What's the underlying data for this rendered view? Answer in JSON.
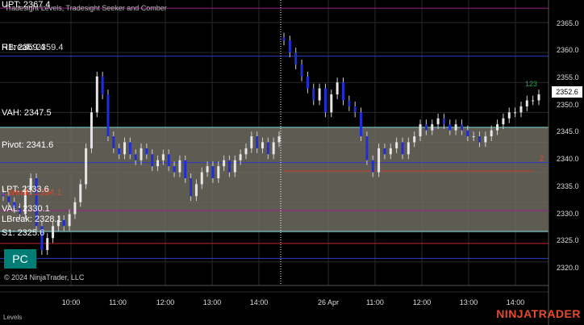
{
  "indicator_title": "Tradesight Levels, Tradesight Seeker and Comber",
  "levels": [
    {
      "key": "upt",
      "label": "UPT: 2367.4",
      "price": 2367.4,
      "color": "#9a1f8c"
    },
    {
      "key": "r1",
      "label": "R1: 2359.4",
      "price": 2359.4,
      "color": "#2b3cc8"
    },
    {
      "key": "vah",
      "label": "VAH: 2347.5",
      "price": 2347.5,
      "color": "#7fd8d8"
    },
    {
      "key": "pivot",
      "label": "Pivot: 2341.6",
      "price": 2341.6,
      "color": "#2b3cc8"
    },
    {
      "key": "lpt",
      "label": "LPT: 2333.6",
      "price": 2333.6,
      "color": "#9a1f8c"
    },
    {
      "key": "val",
      "label": "VAL: 2330.1",
      "price": 2330.1,
      "color": "#7fd8d8"
    },
    {
      "key": "lbreak",
      "label": "LBreak: 2328.1",
      "price": 2328.1,
      "color": "#c9201f"
    },
    {
      "key": "s1",
      "label": "S1: 2325.6",
      "price": 2325.6,
      "color": "#2b3cc8"
    }
  ],
  "overlap_labels": [
    "HBreak: 2359.4",
    "LBreak: 2334.1"
  ],
  "red_level_price": 2340.2,
  "pc_button": "PC",
  "copyright": "© 2024 NinjaTrader, LLC",
  "panel_label": "Levels",
  "brand": "NINJATRADER",
  "last_price": "2352.6",
  "markers": {
    "green": "123",
    "red": "2"
  },
  "chart_data": {
    "type": "candlestick",
    "y_ticks": [
      "2365.0",
      "2360.0",
      "2355.0",
      "2350.0",
      "2345.0",
      "2340.0",
      "2335.0",
      "2330.0",
      "2325.0",
      "2320.0"
    ],
    "ylim": [
      2318.0,
      2368.5
    ],
    "x_ticks": [
      "10:00",
      "11:00",
      "12:00",
      "13:00",
      "14:00",
      "26 Apr",
      "11:00",
      "12:00",
      "13:00",
      "14:00"
    ],
    "last_price": 2352.6,
    "session_one_closes": [
      2336,
      2335,
      2334,
      2333,
      2337,
      2339,
      2331,
      2327,
      2329,
      2331,
      2332,
      2331,
      2333,
      2335,
      2338,
      2344,
      2350,
      2356,
      2353,
      2346,
      2344,
      2343,
      2345,
      2343,
      2342,
      2344,
      2343,
      2341,
      2342,
      2343,
      2341,
      2340,
      2342,
      2339,
      2336,
      2338,
      2340,
      2341,
      2339,
      2341,
      2342,
      2340,
      2342,
      2343,
      2344,
      2346,
      2344,
      2345,
      2343,
      2345,
      2346
    ],
    "session_two_closes": [
      2362,
      2360,
      2358,
      2356,
      2354,
      2352,
      2354,
      2350,
      2353,
      2355,
      2352,
      2351,
      2350,
      2346,
      2342,
      2340,
      2344,
      2343,
      2344,
      2345,
      2343,
      2345,
      2346,
      2348,
      2347,
      2348,
      2349,
      2348,
      2347,
      2348,
      2347,
      2346,
      2346,
      2345,
      2346,
      2347,
      2348,
      2349,
      2350,
      2350,
      2351,
      2352,
      2352,
      2353
    ]
  }
}
